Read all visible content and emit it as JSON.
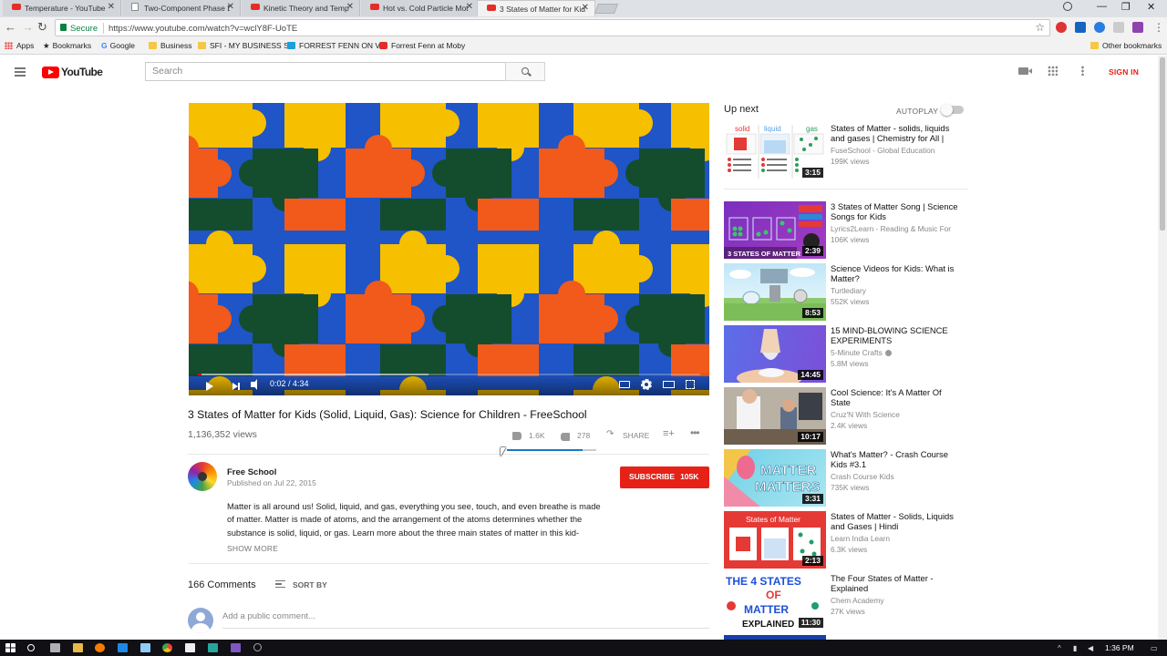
{
  "browser": {
    "tabs": [
      {
        "title": "Temperature - YouTube",
        "type": "youtube",
        "active": false
      },
      {
        "title": "Two-Component Phase D",
        "type": "doc",
        "active": false
      },
      {
        "title": "Kinetic Theory and Temp",
        "type": "youtube",
        "active": false
      },
      {
        "title": "Hot vs. Cold Particle Mot",
        "type": "youtube",
        "active": false
      },
      {
        "title": "3 States of Matter for Kids",
        "type": "youtube",
        "active": true
      }
    ],
    "secure_label": "Secure",
    "url": "https://www.youtube.com/watch?v=wclY8F-UoTE",
    "bookmarks": [
      {
        "label": "Apps",
        "icon": "apps-grid-icon"
      },
      {
        "label": "Bookmarks",
        "icon": "star-icon"
      },
      {
        "label": "Google",
        "icon": "google-icon"
      },
      {
        "label": "Business",
        "icon": "folder-icon"
      },
      {
        "label": "SFI - MY BUSINESS S",
        "icon": "folder-icon"
      },
      {
        "label": "FORREST FENN ON V",
        "icon": "vimeo-icon"
      },
      {
        "label": "Forrest Fenn at Moby",
        "icon": "youtube-icon"
      }
    ],
    "other_bookmarks": "Other bookmarks"
  },
  "youtube": {
    "logo_text": "YouTube",
    "search_placeholder": "Search",
    "sign_in": "SIGN IN",
    "player": {
      "time": "0:02 / 4:34",
      "played_fraction": 0.007,
      "buffered_fraction": 0.46
    },
    "video": {
      "title": "3 States of Matter for Kids (Solid, Liquid, Gas): Science for Children - FreeSchool",
      "views": "1,136,352 views",
      "likes": "1.6K",
      "dislikes": "278",
      "share": "SHARE",
      "like_fraction": 0.85
    },
    "channel": {
      "name": "Free School",
      "published": "Published on Jul 22, 2015",
      "subscribe_label": "SUBSCRIBE",
      "subscribers": "105K"
    },
    "description": "Matter is all around us! Solid, liquid, and gas, everything you see, touch, and even breathe is made of matter. Matter is made of atoms, and the arrangement of the atoms determines whether the substance is solid, liquid, or gas. Learn more about the three main states of matter in this kid-",
    "show_more": "SHOW MORE",
    "comments": {
      "count": "166 Comments",
      "sort_by": "SORT BY",
      "placeholder": "Add a public comment..."
    },
    "sidebar": {
      "up_next": "Up next",
      "autoplay": "AUTOPLAY",
      "autoplay_on": false,
      "items": [
        {
          "title": "States of Matter - solids, liquids and gases | Chemistry for All |",
          "channel": "FuseSchool - Global Education",
          "views": "199K views",
          "duration": "3:15",
          "verified": false
        },
        {
          "title": "3 States of Matter Song | Science Songs for Kids",
          "channel": "Lyrics2Learn - Reading & Music For",
          "views": "106K views",
          "duration": "2:39",
          "verified": false
        },
        {
          "title": "Science Videos for Kids: What is Matter?",
          "channel": "Turtlediary",
          "views": "552K views",
          "duration": "8:53",
          "verified": false
        },
        {
          "title": "15 MIND-BLOWING SCIENCE EXPERIMENTS",
          "channel": "5-Minute Crafts",
          "views": "5.8M views",
          "duration": "14:45",
          "verified": true
        },
        {
          "title": "Cool Science: It's A Matter Of State",
          "channel": "Cruz'N With Science",
          "views": "2.4K views",
          "duration": "10:17",
          "verified": false
        },
        {
          "title": "What's Matter? - Crash Course Kids #3.1",
          "channel": "Crash Course Kids",
          "views": "735K views",
          "duration": "3:31",
          "verified": false
        },
        {
          "title": "States of Matter - Solids, Liquids and Gases | Hindi",
          "channel": "Learn India Learn",
          "views": "6.3K views",
          "duration": "2:13",
          "verified": false
        },
        {
          "title": "The Four States of Matter - Explained",
          "channel": "Chem Academy",
          "views": "27K views",
          "duration": "11:30",
          "verified": false
        }
      ],
      "thumb_texts": {
        "fuse": [
          "solid",
          "liquid",
          "gas"
        ],
        "song": "3 STATES OF MATTER",
        "crash": [
          "MATTER",
          "MATTERS"
        ],
        "hindi": "States of Matter",
        "four": [
          "THE 4 STATES",
          "OF",
          "MATTER",
          "EXPLAINED"
        ]
      }
    }
  },
  "taskbar": {
    "time": "1:36 PM"
  },
  "colors": {
    "youtube_red": "#ff0000",
    "subscribe_red": "#e62117",
    "puzzle_blue": "#1f55c6",
    "puzzle_yellow": "#f6bf00",
    "puzzle_orange": "#f15a1a",
    "puzzle_green": "#144d2e"
  }
}
